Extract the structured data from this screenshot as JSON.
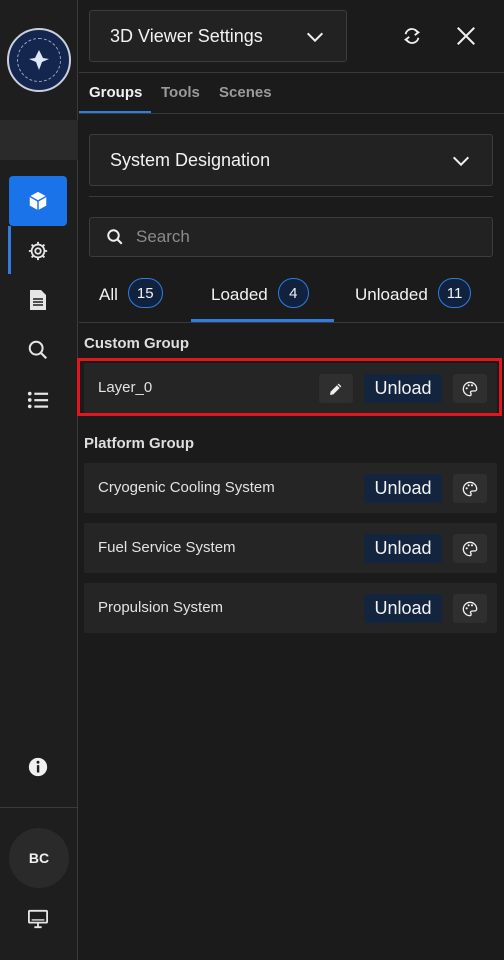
{
  "header": {
    "title": "3D Viewer Settings"
  },
  "tabs": [
    {
      "label": "Groups",
      "active": true
    },
    {
      "label": "Tools",
      "active": false
    },
    {
      "label": "Scenes",
      "active": false
    }
  ],
  "group_select": {
    "value": "System Designation"
  },
  "search": {
    "placeholder": "Search",
    "value": ""
  },
  "filters": [
    {
      "label": "All",
      "count": "15",
      "active": false
    },
    {
      "label": "Loaded",
      "count": "4",
      "active": true
    },
    {
      "label": "Unloaded",
      "count": "11",
      "active": false
    }
  ],
  "sections": [
    {
      "label": "Custom Group",
      "rows": [
        {
          "name": "Layer_0",
          "action": "Unload",
          "editable": true,
          "highlighted": true
        }
      ]
    },
    {
      "label": "Platform Group",
      "rows": [
        {
          "name": "Cryogenic Cooling System",
          "action": "Unload",
          "editable": false
        },
        {
          "name": "Fuel Service System",
          "action": "Unload",
          "editable": false
        },
        {
          "name": "Propulsion System",
          "action": "Unload",
          "editable": false
        }
      ]
    }
  ],
  "sidebar": {
    "items": [
      {
        "icon": "cube-icon",
        "active": true
      },
      {
        "icon": "gear-icon",
        "active": false
      },
      {
        "icon": "document-icon",
        "active": false
      },
      {
        "icon": "search-icon",
        "active": false
      },
      {
        "icon": "list-icon",
        "active": false
      }
    ],
    "avatar_initials": "BC"
  },
  "colors": {
    "accent": "#2f7de1",
    "active_bg": "#1a73e8",
    "highlight": "#e0171f",
    "button_bg": "#13243f"
  }
}
